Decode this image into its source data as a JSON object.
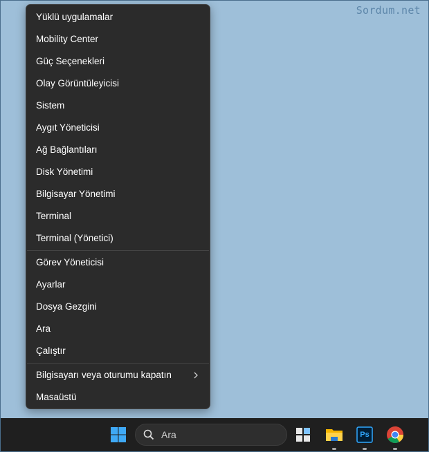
{
  "watermark": "Sordum.net",
  "menu": {
    "items": [
      {
        "label": "Yüklü uygulamalar"
      },
      {
        "label": "Mobility Center"
      },
      {
        "label": "Güç Seçenekleri"
      },
      {
        "label": "Olay Görüntüleyicisi"
      },
      {
        "label": "Sistem"
      },
      {
        "label": "Aygıt Yöneticisi"
      },
      {
        "label": "Ağ Bağlantıları"
      },
      {
        "label": "Disk Yönetimi"
      },
      {
        "label": "Bilgisayar Yönetimi"
      },
      {
        "label": "Terminal"
      },
      {
        "label": "Terminal (Yönetici)"
      },
      {
        "label": "Görev Yöneticisi"
      },
      {
        "label": "Ayarlar"
      },
      {
        "label": "Dosya Gezgini"
      },
      {
        "label": "Ara"
      },
      {
        "label": "Çalıştır"
      },
      {
        "label": "Bilgisayarı veya oturumu kapatın",
        "icon": "chevron-right-icon"
      },
      {
        "label": "Masaüstü"
      }
    ]
  },
  "taskbar": {
    "search_placeholder": "Ara",
    "icons": [
      "windows-start-icon",
      "search-icon",
      "task-view-icon",
      "file-explorer-icon",
      "photoshop-icon",
      "chrome-icon"
    ],
    "photoshop_label": "Ps"
  }
}
